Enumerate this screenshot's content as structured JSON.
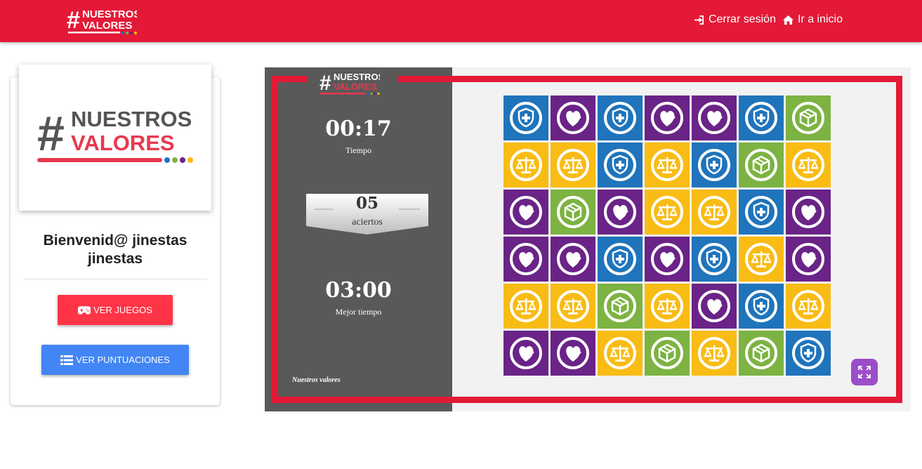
{
  "brand": {
    "hash": "#",
    "line1": "NUESTROS",
    "line2": "VALORES"
  },
  "nav": {
    "logout": "Cerrar sesión",
    "home": "Ir a inicio"
  },
  "sidebar": {
    "welcome_line1": "Bienvenid@ jinestas",
    "welcome_line2": "jinestas",
    "games_button": "VER JUEGOS",
    "scores_button": "VER PUNTUACIONES"
  },
  "game": {
    "time_value": "00:17",
    "time_label": "Tiempo",
    "hits_value": "05",
    "hits_label": "aciertos",
    "best_value": "03:00",
    "best_label": "Mejor tiempo",
    "footer": "Nuestros valores"
  },
  "board": {
    "colors": {
      "shield": "#1f74bb",
      "heart": "#6a2387",
      "scale": "#f9bc15",
      "cube": "#7cb342"
    },
    "rows": [
      [
        "shield",
        "heart",
        "shield",
        "heart",
        "heart",
        "shield",
        "cube"
      ],
      [
        "scale",
        "scale",
        "shield",
        "scale",
        "shield",
        "cube",
        "scale"
      ],
      [
        "heart",
        "cube",
        "heart",
        "scale",
        "scale",
        "shield",
        "heart"
      ],
      [
        "heart",
        "heart",
        "shield",
        "heart",
        "shield",
        "scale",
        "heart"
      ],
      [
        "scale",
        "scale",
        "cube",
        "scale",
        "heart",
        "shield",
        "scale"
      ],
      [
        "heart",
        "heart",
        "scale",
        "cube",
        "scale",
        "cube",
        "shield"
      ]
    ]
  },
  "colors": {
    "brand_red": "#e31937",
    "panel_gray": "#595959",
    "btn_red": "#ff3547",
    "btn_blue": "#4285f4",
    "fullscreen_purple": "#9b4dca"
  },
  "icons": {
    "logout": "sign-in-icon",
    "home": "home-icon",
    "games": "gamepad-icon",
    "scores": "list-icon",
    "fullscreen": "expand-icon"
  }
}
